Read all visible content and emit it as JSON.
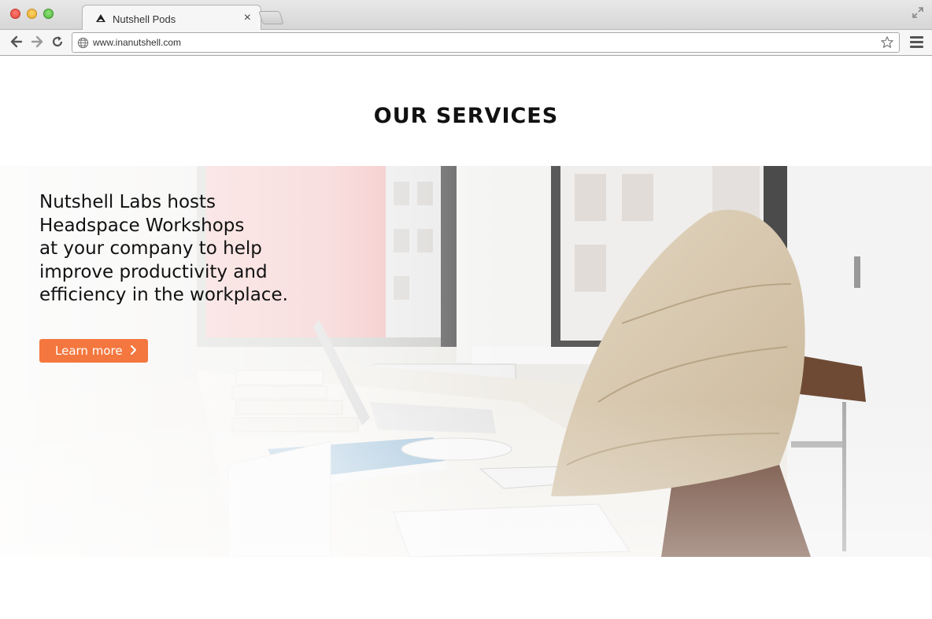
{
  "browser": {
    "tab_title": "Nutshell Pods",
    "tab_close": "×",
    "url": "www.inanutshell.com",
    "icons": [
      "close-window-icon",
      "minimize-window-icon",
      "zoom-window-icon",
      "fullscreen-icon",
      "back-icon",
      "forward-icon",
      "reload-icon",
      "globe-icon",
      "star-icon",
      "menu-icon"
    ]
  },
  "page": {
    "section_title": "OUR SERVICES",
    "hero": {
      "lines": [
        "Nutshell Labs hosts",
        "Headspace Workshops",
        "at your company to help",
        "improve productivity and",
        "efficiency in the workplace."
      ],
      "cta_label": "Learn more",
      "cta_color": "#f4773f"
    }
  }
}
